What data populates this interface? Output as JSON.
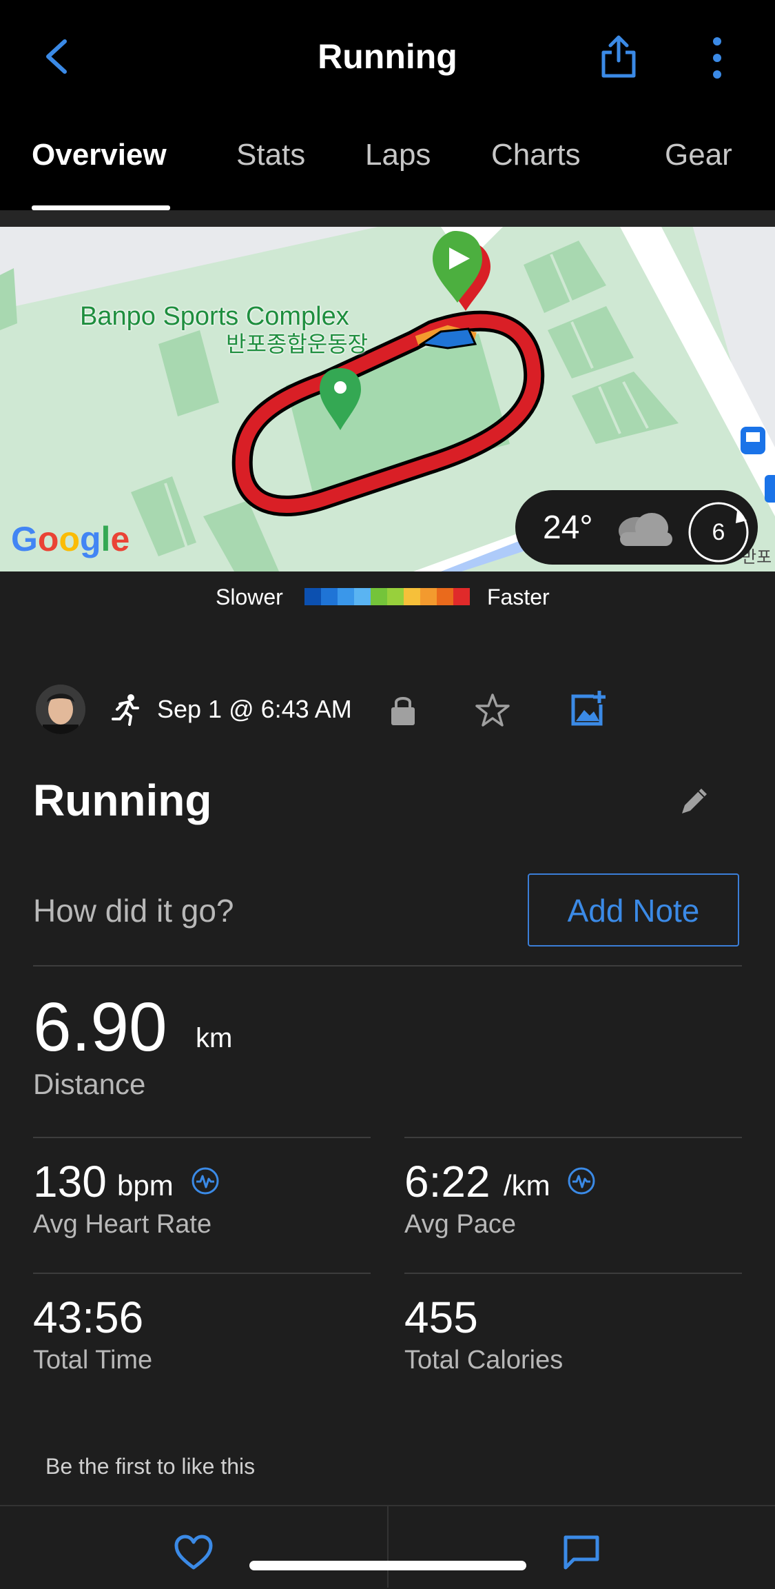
{
  "header": {
    "title": "Running",
    "tabs": [
      "Overview",
      "Stats",
      "Laps",
      "Charts",
      "Gear"
    ],
    "active_tab": "Overview"
  },
  "map": {
    "place_name": "Banpo Sports Complex",
    "place_name_ko": "반포종합운동장",
    "logo": "Google",
    "edge_label": "반포"
  },
  "weather": {
    "temperature": "24°",
    "condition_icon": "cloud-icon",
    "wind_speed": "6"
  },
  "legend": {
    "slower": "Slower",
    "faster": "Faster",
    "colors": [
      "#0c50b0",
      "#1f74d6",
      "#3a97ea",
      "#5ab4f2",
      "#74c43a",
      "#98d03c",
      "#f6c03a",
      "#f39a2e",
      "#ea6a1c",
      "#e02a2a"
    ]
  },
  "activity": {
    "date": "Sep 1 @ 6:43 AM",
    "title": "Running",
    "note_prompt": "How did it go?",
    "add_note_label": "Add Note"
  },
  "stats": {
    "distance": {
      "value": "6.90",
      "unit": "km",
      "label": "Distance"
    },
    "avg_heart_rate": {
      "value": "130",
      "unit": "bpm",
      "label": "Avg Heart Rate"
    },
    "avg_pace": {
      "value": "6:22",
      "unit": "/km",
      "label": "Avg Pace"
    },
    "total_time": {
      "value": "43:56",
      "label": "Total Time"
    },
    "total_calories": {
      "value": "455",
      "label": "Total Calories"
    }
  },
  "social": {
    "likes_text": "Be the first to like this"
  },
  "colors": {
    "accent": "#3b8ae6",
    "route": "#d91f26",
    "background": "#1e1e1e"
  }
}
